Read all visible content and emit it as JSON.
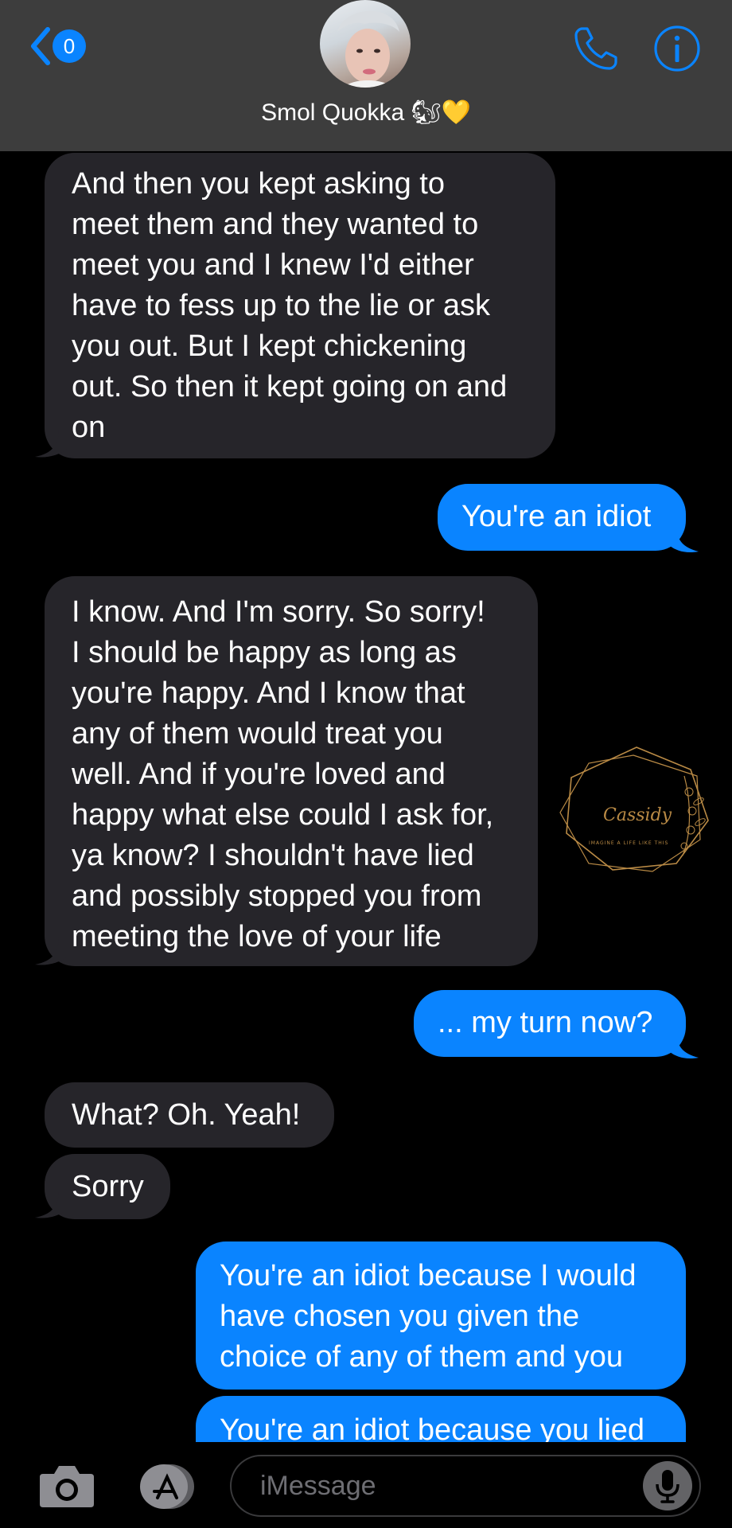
{
  "header": {
    "back_badge": "0",
    "contact_name": "Smol Quokka 🐿💛"
  },
  "messages": [
    {
      "from": "them",
      "lines": [
        "And then you kept asking to",
        "meet them and they wanted to",
        "meet you and I knew I'd either",
        "have to fess up to the lie or ask",
        "you out. But I kept chickening",
        "out. So then it kept going on and",
        "on"
      ]
    },
    {
      "from": "me",
      "lines": [
        "You're an idiot"
      ]
    },
    {
      "from": "them",
      "lines": [
        "I know. And I'm sorry. So sorry!",
        "I should be happy as long as",
        "you're happy. And I know that",
        "any of them would treat you",
        "well. And if you're loved and",
        "happy what else could I ask for,",
        "ya know? I shouldn't have lied",
        "and possibly stopped you from",
        "meeting the love of your life"
      ]
    },
    {
      "from": "me",
      "lines": [
        "... my turn now?"
      ]
    },
    {
      "from": "them",
      "lines": [
        "What? Oh. Yeah!"
      ]
    },
    {
      "from": "them",
      "lines": [
        "Sorry"
      ]
    },
    {
      "from": "me",
      "lines": [
        "You're an idiot because I would",
        "have chosen you given the",
        "choice of any of them and you"
      ]
    },
    {
      "from": "me",
      "lines": [
        "You're an idiot because you lied"
      ]
    }
  ],
  "watermark": {
    "brand": "Cassidy",
    "tagline": "IMAGINE A LIFE LIKE THIS"
  },
  "compose": {
    "placeholder": "iMessage"
  },
  "colors": {
    "sent_bubble": "#0a84ff",
    "received_bubble": "#26252a",
    "header_bg": "#3d3d3d",
    "watermark_gold": "#b98a45"
  }
}
